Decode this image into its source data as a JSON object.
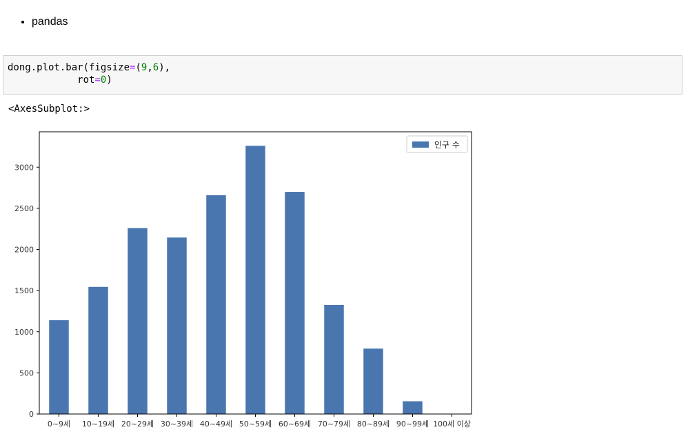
{
  "notebook": {
    "bullet_items": [
      "pandas"
    ],
    "code": {
      "line1": {
        "pre": "dong.plot.bar(figsize",
        "op": "=",
        "paren_open": "(",
        "num1": "9",
        "comma": ",",
        "num2": "6",
        "tail": "),"
      },
      "line2": {
        "indent": "            ",
        "name": "rot",
        "op": "=",
        "num": "0",
        "tail": ")"
      }
    },
    "output_text": "<AxesSubplot:>"
  },
  "colors": {
    "bar": "#4a76b0",
    "axis": "#000000",
    "tick_text": "#333333",
    "code_bg": "#f7f7f7",
    "op": "#aa22ff",
    "num": "#008000"
  },
  "chart_data": {
    "type": "bar",
    "categories": [
      "0~9세",
      "10~19세",
      "20~29세",
      "30~39세",
      "40~49세",
      "50~59세",
      "60~69세",
      "70~79세",
      "80~89세",
      "90~99세",
      "100세 이상"
    ],
    "series": [
      {
        "name": "인구 수",
        "values": [
          1140,
          1545,
          2260,
          2145,
          2660,
          3260,
          2700,
          1325,
          795,
          155,
          0
        ]
      }
    ],
    "ylim": [
      0,
      3430
    ],
    "yticks": [
      0,
      500,
      1000,
      1500,
      2000,
      2500,
      3000
    ],
    "legend_position": "top-right",
    "grid": false
  }
}
